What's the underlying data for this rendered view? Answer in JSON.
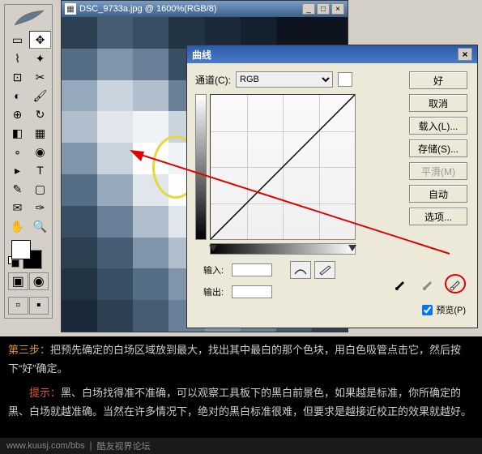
{
  "doc": {
    "filename": "DSC_9733a.jpg",
    "zoom": "1600%",
    "mode": "RGB/8"
  },
  "dialog": {
    "title": "曲线",
    "channel_label": "通道(C):",
    "channel_value": "RGB",
    "input_label": "输入:",
    "output_label": "输出:",
    "preview_label": "预览(P)",
    "preview_checked": true,
    "buttons": {
      "ok": "好",
      "cancel": "取消",
      "load": "载入(L)...",
      "save": "存储(S)...",
      "smooth": "平滑(M)",
      "auto": "自动",
      "options": "选项..."
    }
  },
  "caption": {
    "step": "第三步：",
    "step_text": "把预先确定的白场区域放到最大，找出其中最白的那个色块，用白色吸管点击它，然后按下“好”确定。",
    "tip": "提示：",
    "tip_text": "黑、白场找得准不准确，可以观察工具板下的黑白前景色，如果越是标准，你所确定的黑、白场就越准确。当然在许多情况下，绝对的黑白标准很难，但要求是越接近校正的效果就越好。"
  },
  "footer": {
    "url": "www.kuusj.com/bbs",
    "site": "酷友视界论坛"
  },
  "pixel_colors": [
    "#0d1420",
    "#13202e",
    "#1a2a3a",
    "#223444",
    "#2c4052",
    "#384e62",
    "#455c72",
    "#556d85",
    "#6a8098",
    "#8094aa",
    "#96a8bc",
    "#b0bece",
    "#cad4de",
    "#e0e6ec",
    "#f0f3f6",
    "#ffffff",
    "#0a1624",
    "#142230",
    "#242a36",
    "#303a46",
    "#1e2c3a",
    "#4a5866",
    "#5e6e7e",
    "#72828e"
  ]
}
